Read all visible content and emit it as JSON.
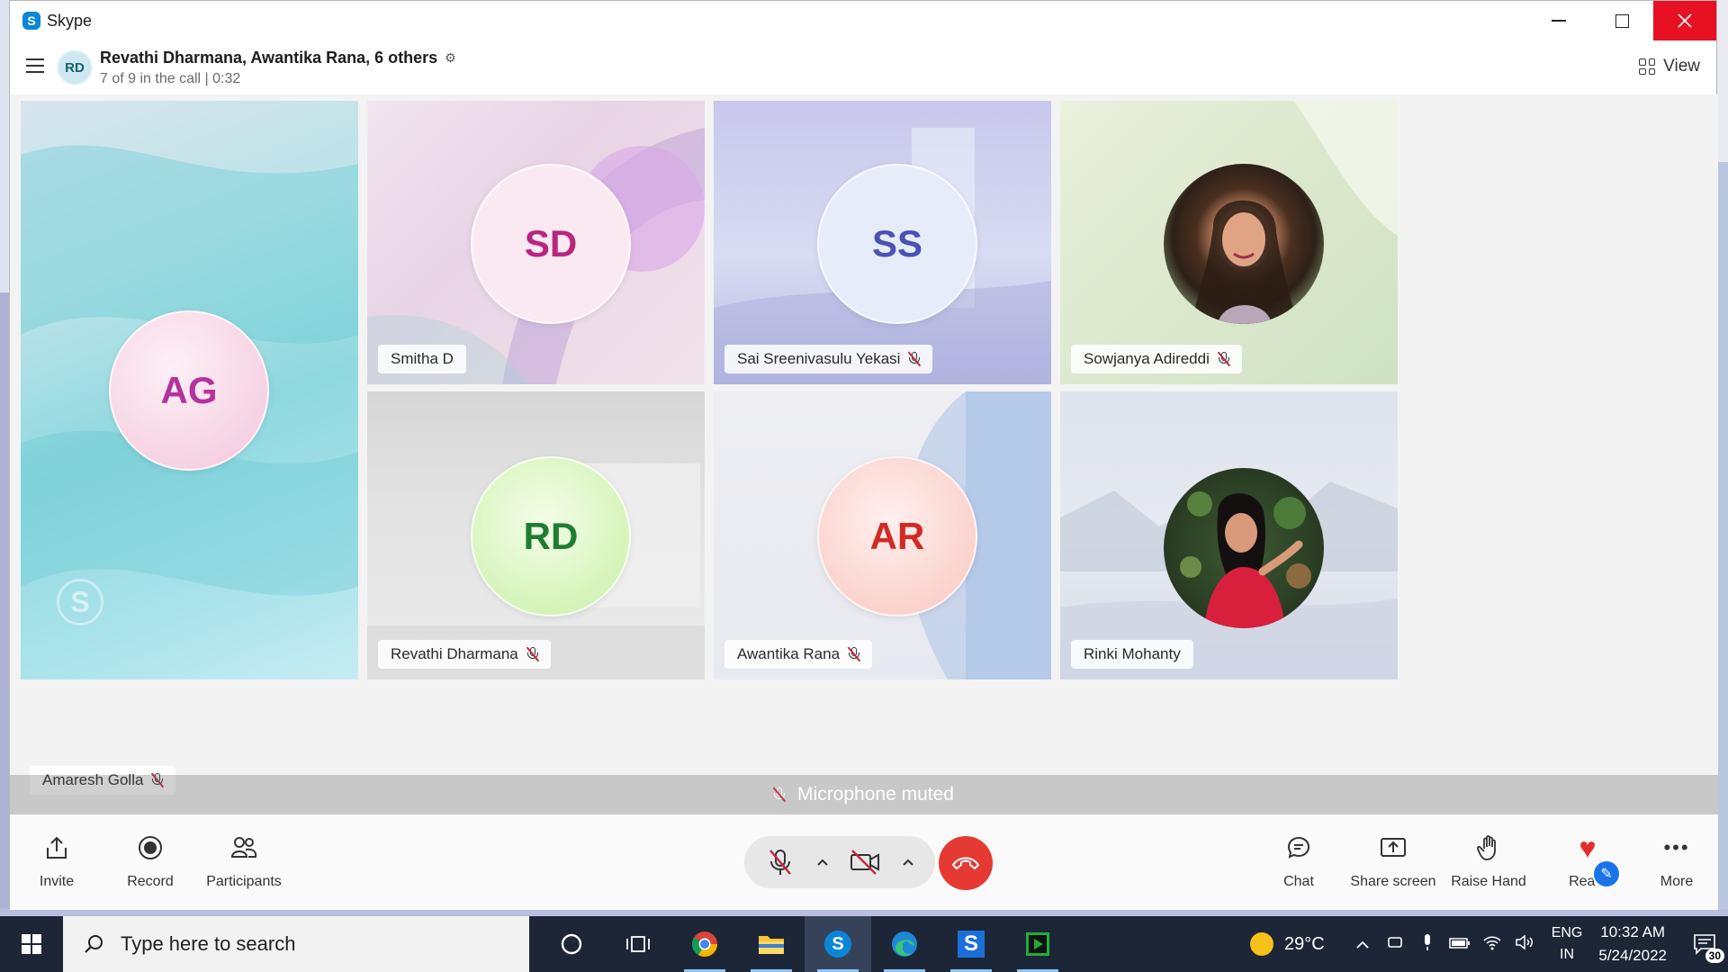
{
  "window": {
    "title": "Skype",
    "logo_letter": "S"
  },
  "call": {
    "avatar": "RD",
    "title": "Revathi Dharmana, Awantika Rana, 6 others",
    "subtitle": "7 of 9 in the call | 0:32",
    "view_label": "View"
  },
  "participants": [
    {
      "initials": "AG",
      "name": "Amaresh Golla",
      "muted": true
    },
    {
      "initials": "SD",
      "name": "Smitha D",
      "muted": false
    },
    {
      "initials": "SS",
      "name": "Sai Sreenivasulu Yekasi",
      "muted": true
    },
    {
      "initials": "",
      "name": "Sowjanya Adireddi",
      "muted": true
    },
    {
      "initials": "RD",
      "name": "Revathi Dharmana",
      "muted": true
    },
    {
      "initials": "AR",
      "name": "Awantika Rana",
      "muted": true
    },
    {
      "initials": "",
      "name": "Rinki Mohanty",
      "muted": false
    }
  ],
  "banner": {
    "text": "Microphone muted"
  },
  "toolbar": {
    "invite": "Invite",
    "record": "Record",
    "participants": "Participants",
    "chat": "Chat",
    "share_screen": "Share screen",
    "raise_hand": "Raise Hand",
    "react": "React",
    "more": "More"
  },
  "taskbar": {
    "search_placeholder": "Type here to search",
    "temperature": "29°C",
    "lang_top": "ENG",
    "lang_bottom": "IN",
    "time": "10:32 AM",
    "date": "5/24/2022",
    "notification_count": "30"
  },
  "colors": {
    "hangup": "#e43a33",
    "close_button": "#e81123",
    "skype_blue": "#0a86d8",
    "taskbar": "#1d2636"
  }
}
